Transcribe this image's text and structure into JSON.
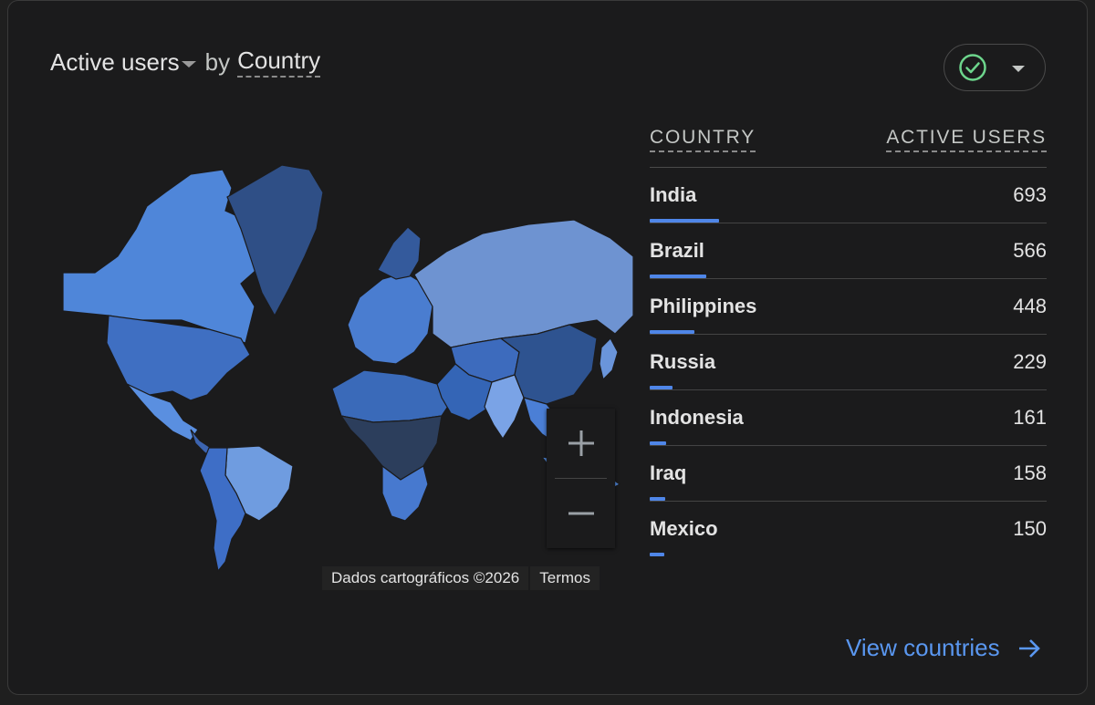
{
  "card": {
    "title": {
      "metric": "Active users",
      "by": "by",
      "dimension": "Country"
    }
  },
  "map": {
    "attribution": "Dados cartográficos ©2026",
    "terms": "Termos",
    "zoom_in_icon": "plus-icon",
    "zoom_out_icon": "minus-icon"
  },
  "table": {
    "headers": {
      "country": "COUNTRY",
      "active_users": "ACTIVE USERS"
    },
    "rows": [
      {
        "country": "India",
        "value": "693",
        "share": 1.0
      },
      {
        "country": "Brazil",
        "value": "566",
        "share": 0.817
      },
      {
        "country": "Philippines",
        "value": "448",
        "share": 0.646
      },
      {
        "country": "Russia",
        "value": "229",
        "share": 0.33
      },
      {
        "country": "Indonesia",
        "value": "161",
        "share": 0.232
      },
      {
        "country": "Iraq",
        "value": "158",
        "share": 0.228
      },
      {
        "country": "Mexico",
        "value": "150",
        "share": 0.216
      }
    ]
  },
  "footer": {
    "view_link": "View countries"
  },
  "colors": {
    "accent": "#4f86e8",
    "link": "#5a97f0",
    "check": "#6dd58c"
  }
}
